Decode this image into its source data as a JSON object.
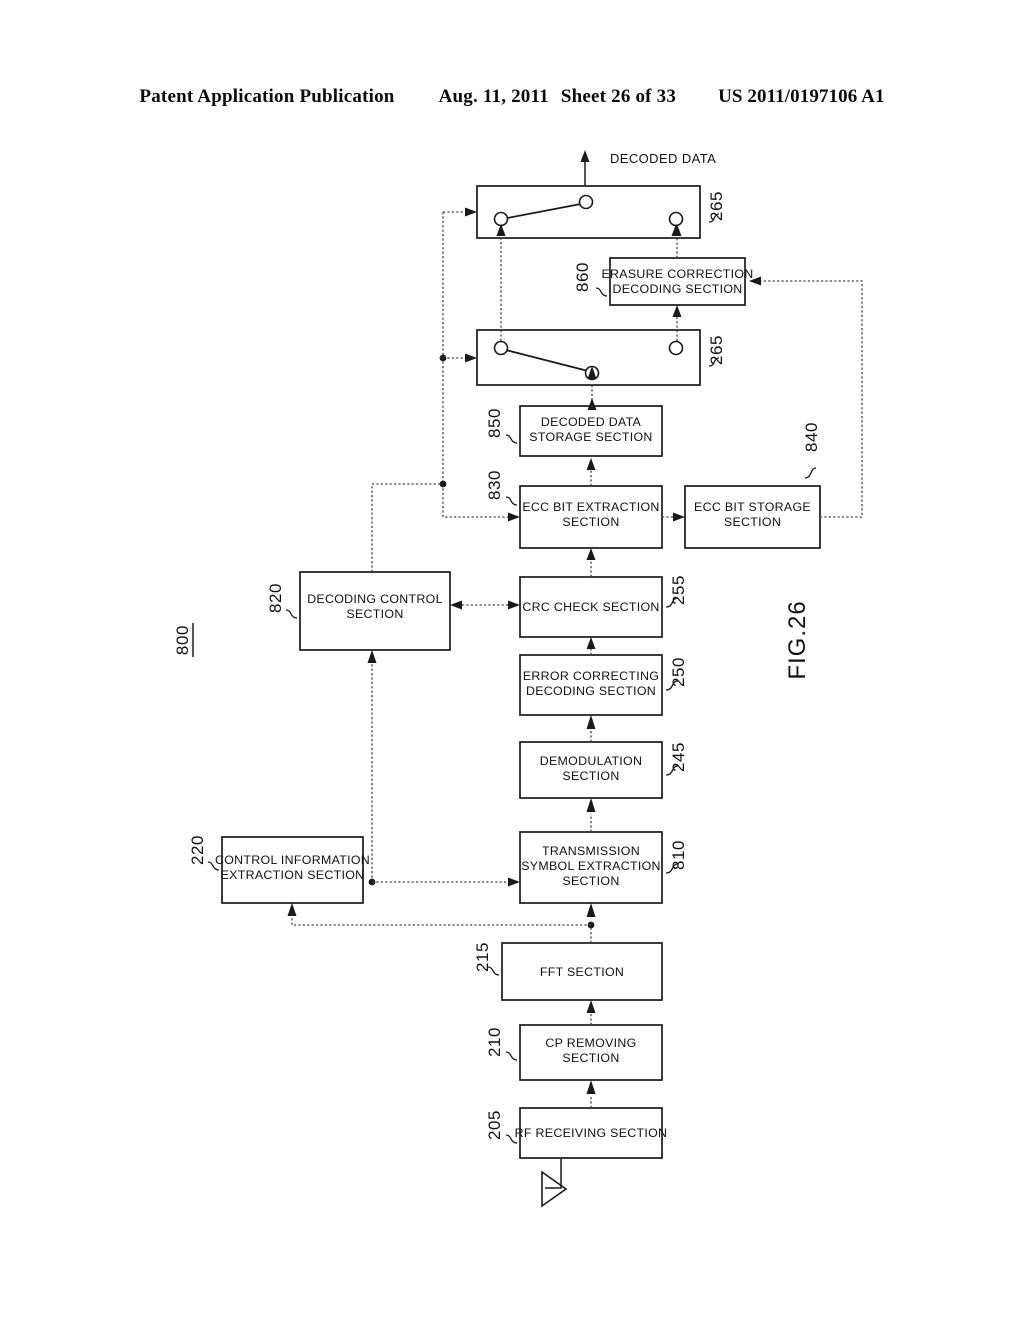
{
  "header": {
    "publication": "Patent Application Publication",
    "date": "Aug. 11, 2011",
    "sheet": "Sheet 26 of 33",
    "patent_number": "US 2011/0197106 A1"
  },
  "figure": {
    "title": "FIG.26",
    "device_number": "800",
    "output_label": "DECODED DATA"
  },
  "blocks": [
    {
      "id": "switch_top",
      "ref": "265",
      "label_lines": []
    },
    {
      "id": "erasure_correction",
      "ref": "860",
      "label_lines": [
        "ERASURE CORRECTION",
        "DECODING SECTION"
      ]
    },
    {
      "id": "switch_bottom",
      "ref": "265",
      "label_lines": []
    },
    {
      "id": "decoded_data_storage",
      "ref": "850",
      "label_lines": [
        "DECODED DATA",
        "STORAGE SECTION"
      ]
    },
    {
      "id": "ecc_bit_extraction",
      "ref": "830",
      "label_lines": [
        "ECC BIT EXTRACTION",
        "SECTION"
      ]
    },
    {
      "id": "ecc_bit_storage",
      "ref": "840",
      "label_lines": [
        "ECC BIT STORAGE",
        "SECTION"
      ]
    },
    {
      "id": "decoding_control",
      "ref": "820",
      "label_lines": [
        "DECODING CONTROL",
        "SECTION"
      ]
    },
    {
      "id": "crc_check",
      "ref": "255",
      "label_lines": [
        "CRC CHECK SECTION"
      ]
    },
    {
      "id": "error_correcting",
      "ref": "250",
      "label_lines": [
        "ERROR CORRECTING",
        "DECODING SECTION"
      ]
    },
    {
      "id": "demodulation",
      "ref": "245",
      "label_lines": [
        "DEMODULATION",
        "SECTION"
      ]
    },
    {
      "id": "control_info",
      "ref": "220",
      "label_lines": [
        "CONTROL INFORMATION",
        "EXTRACTION SECTION"
      ]
    },
    {
      "id": "tx_symbol_extract",
      "ref": "810",
      "label_lines": [
        "TRANSMISSION",
        "SYMBOL EXTRACTION",
        "SECTION"
      ]
    },
    {
      "id": "fft",
      "ref": "215",
      "label_lines": [
        "FFT SECTION"
      ]
    },
    {
      "id": "cp_removing",
      "ref": "210",
      "label_lines": [
        "CP REMOVING",
        "SECTION"
      ]
    },
    {
      "id": "rf_receiving",
      "ref": "205",
      "label_lines": [
        "RF RECEIVING SECTION"
      ]
    }
  ],
  "icons": {
    "antenna": "antenna-icon"
  }
}
